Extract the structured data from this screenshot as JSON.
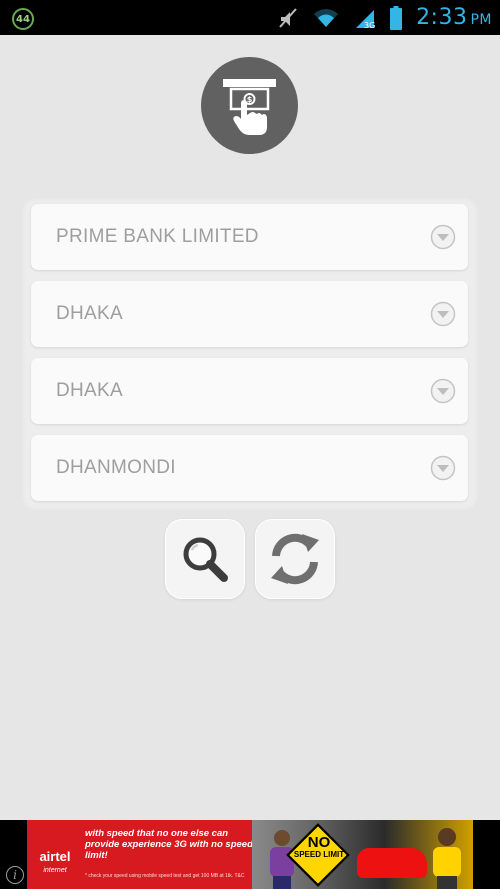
{
  "status_bar": {
    "notification_badge": "44",
    "icons": [
      "mute-icon",
      "wifi-icon",
      "signal-icon",
      "battery-icon"
    ],
    "time": "2:33",
    "ampm": "PM",
    "accent_color": "#33b5e5"
  },
  "header": {
    "logo_icon": "atm-cash-withdrawal-icon"
  },
  "filters": {
    "bank": "PRIME BANK LIMITED",
    "division": "DHAKA",
    "district": "DHAKA",
    "area": "DHANMONDI"
  },
  "actions": {
    "search_icon": "search-icon",
    "refresh_icon": "refresh-icon"
  },
  "ad": {
    "brand": "airtel",
    "brand_sub": "internet",
    "tagline": "with speed that no one else can provide experience 3G with no speed limit!",
    "fine_print": "* check your speed using mobile speed test and get 100 MB at 1tk. T&C",
    "sign_line1": "NO",
    "sign_line2": "SPEED LIMIT",
    "info_label": "i"
  },
  "colors": {
    "background": "#e6e6e6",
    "logo_circle": "#616161",
    "dropdown_text": "#9e9e9e",
    "ad_red": "#d71920"
  }
}
